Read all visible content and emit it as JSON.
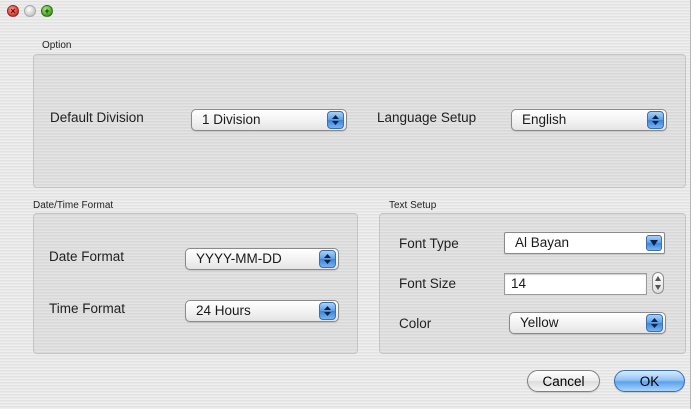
{
  "window": {
    "controls": {
      "close_glyph": "×",
      "zoom_glyph": "+"
    }
  },
  "option": {
    "title": "Option",
    "default_division": {
      "label": "Default Division",
      "value": "1 Division"
    },
    "language_setup": {
      "label": "Language Setup",
      "value": "English"
    }
  },
  "datetime": {
    "title": "Date/Time Format",
    "date_format": {
      "label": "Date Format",
      "value": "YYYY-MM-DD"
    },
    "time_format": {
      "label": "Time Format",
      "value": "24 Hours"
    }
  },
  "text_setup": {
    "title": "Text Setup",
    "font_type": {
      "label": "Font Type",
      "value": "Al Bayan"
    },
    "font_size": {
      "label": "Font Size",
      "value": "14"
    },
    "color": {
      "label": "Color",
      "value": "Yellow"
    }
  },
  "buttons": {
    "cancel": "Cancel",
    "ok": "OK"
  },
  "colors": {
    "accent": "#5fa2ec",
    "window_bg": "#e7e7e7"
  }
}
